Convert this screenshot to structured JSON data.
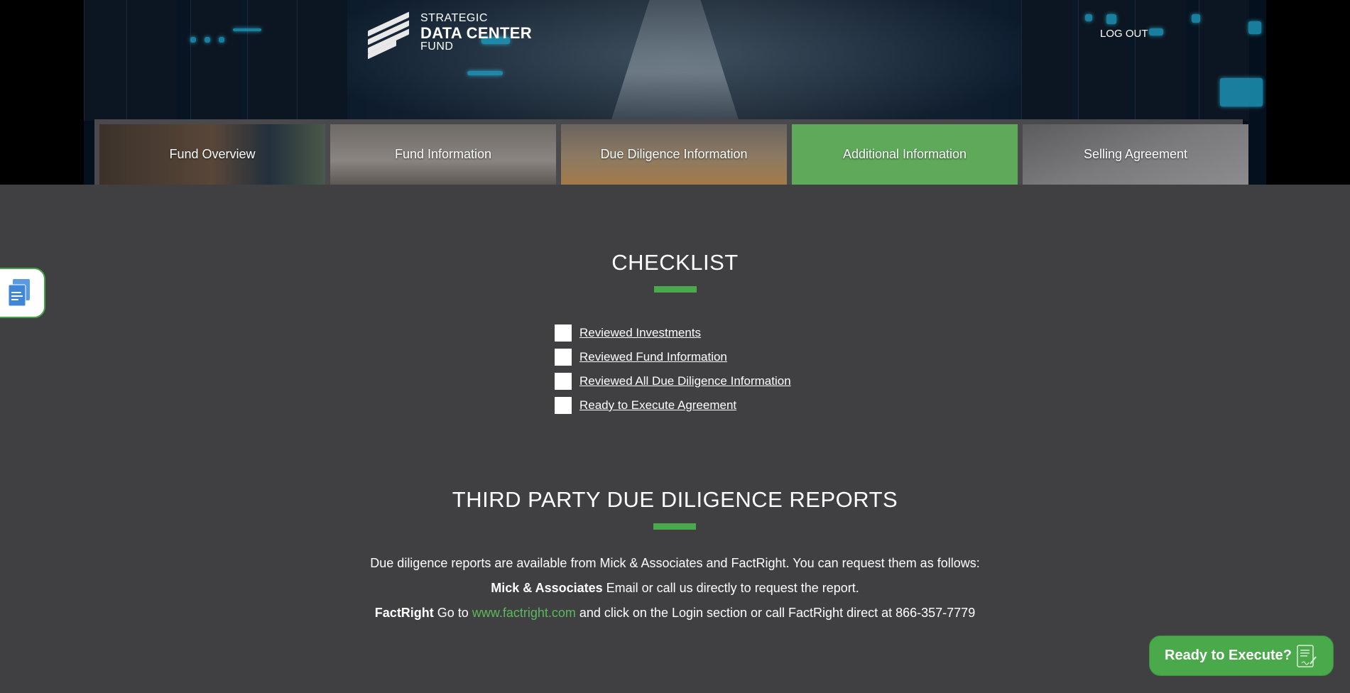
{
  "header": {
    "logo": {
      "line1": "STRATEGIC",
      "line2": "DATA CENTER",
      "line3": "FUND"
    },
    "logout_label": "LOG OUT"
  },
  "tabs": [
    {
      "label": "Fund Overview",
      "active": false
    },
    {
      "label": "Fund Information",
      "active": false
    },
    {
      "label": "Due Diligence Information",
      "active": false
    },
    {
      "label": "Additional Information",
      "active": true
    },
    {
      "label": "Selling Agreement",
      "active": false
    }
  ],
  "checklist": {
    "title": "CHECKLIST",
    "items": [
      {
        "label": "Reviewed Investments",
        "checked": false
      },
      {
        "label": "Reviewed Fund Information",
        "checked": false
      },
      {
        "label": "Reviewed All Due Diligence Information",
        "checked": false
      },
      {
        "label": "Ready to Execute Agreement",
        "checked": false
      }
    ]
  },
  "reports": {
    "title": "THIRD PARTY DUE DILIGENCE REPORTS",
    "intro": "Due diligence reports are available from Mick & Associates and FactRight. You can request them as follows:",
    "mick_name": "Mick & Associates",
    "mick_text": " Email or call us directly to request the report.",
    "factright_name": "FactRight",
    "factright_pre": " Go to ",
    "factright_link": "www.factright.com",
    "factright_post": " and click on the Login section or call FactRight direct at 866-357-7779"
  },
  "ready_button": {
    "label": "Ready to Execute?"
  },
  "colors": {
    "accent_green": "#4aa94a",
    "page_bg": "#404042",
    "link_green": "#5cb85c"
  },
  "icons": {
    "side_float": "documents-icon",
    "ready_button": "signed-document-icon"
  }
}
